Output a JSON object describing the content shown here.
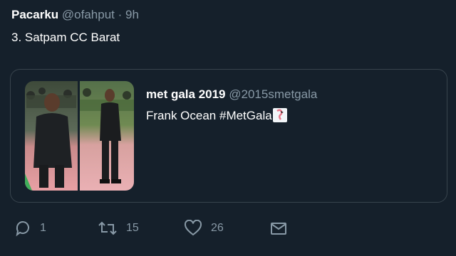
{
  "tweet": {
    "author_name": "Pacarku",
    "author_handle": "@ofahput",
    "separator": "·",
    "time": "9h",
    "text": "3. Satpam CC Barat"
  },
  "quoted_tweet": {
    "author_name": "met gala 2019",
    "author_handle": "@2015smetgala",
    "text": "Frank Ocean #MetGala"
  },
  "actions": {
    "reply_count": "1",
    "retweet_count": "15",
    "like_count": "26"
  },
  "icons": {
    "reply": "reply-icon",
    "retweet": "retweet-icon",
    "like": "heart-icon",
    "share": "mail-icon",
    "emoji": "flamingo-emoji"
  },
  "colors": {
    "background": "#15202b",
    "secondary_text": "#8899a6",
    "card_border": "#38444d"
  }
}
